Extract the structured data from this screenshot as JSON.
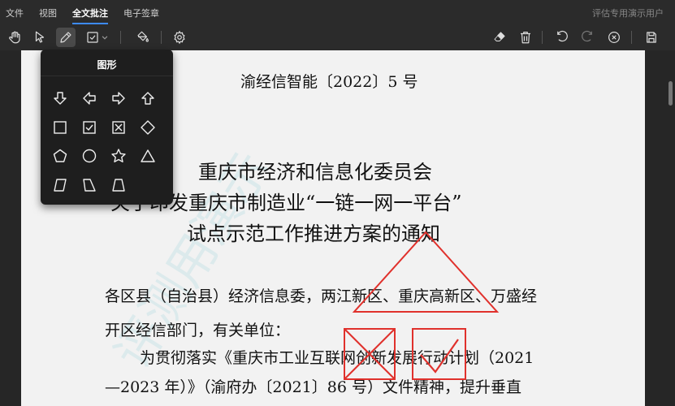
{
  "menubar": {
    "items": [
      "文件",
      "视图",
      "全文批注",
      "电子签章"
    ],
    "active_index": 2,
    "user": "评估专用演示用户"
  },
  "toolbar": {
    "left_tools": [
      "hand-icon",
      "pointer-icon",
      "pen-icon",
      "shape-checkbox-icon",
      "chevron-down-icon",
      "paint-bucket-icon",
      "gear-icon"
    ],
    "right_tools": [
      "eraser-icon",
      "trash-icon",
      "undo-icon",
      "redo-icon",
      "close-circle-icon",
      "save-icon"
    ]
  },
  "shapes_panel": {
    "title": "图形",
    "shapes": [
      "arrow-down-icon",
      "arrow-left-icon",
      "arrow-right-icon",
      "arrow-up-icon",
      "square-icon",
      "checked-square-icon",
      "crossed-square-icon",
      "diamond-icon",
      "pentagon-icon",
      "circle-icon",
      "star-icon",
      "triangle-icon",
      "parallelogram-icon",
      "trapezoid-left-icon",
      "trapezoid-icon"
    ]
  },
  "document": {
    "doc_number": "渝经信智能〔2022〕5 号",
    "title_lines": [
      "重庆市经济和信息化委员会",
      "关于印发重庆市制造业“一链一网一平台”",
      "试点示范工作推进方案的通知"
    ],
    "body_lines": [
      "各区县（自治县）经济信息委，两江新区、重庆高新区、万盛经",
      "开区经信部门，有关单位：",
      "为贯彻落实《重庆市工业互联网创新发展行动计划（2021",
      "—2023 年）》（渝府办〔2021〕86 号）文件精神，提升垂直"
    ],
    "watermark": "评测用演示",
    "annotation_color": "#e0312c"
  }
}
